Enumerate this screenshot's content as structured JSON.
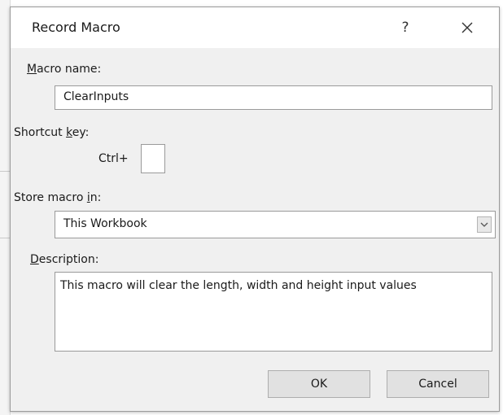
{
  "dialog": {
    "title": "Record Macro",
    "help_glyph": "?",
    "close_glyph": "✕"
  },
  "macro_name": {
    "label_hotkey": "M",
    "label_rest": "acro name:",
    "value": "ClearInputs"
  },
  "shortcut_key": {
    "label_pre": "Shortcut ",
    "label_hotkey": "k",
    "label_post": "ey:",
    "prefix": "Ctrl+",
    "value": ""
  },
  "store_macro": {
    "label_pre": "Store macro ",
    "label_hotkey": "i",
    "label_post": "n:",
    "selected": "This Workbook"
  },
  "description": {
    "label_hotkey": "D",
    "label_rest": "escription:",
    "value": "This macro will clear the length, width and height input values"
  },
  "buttons": {
    "ok": "OK",
    "cancel": "Cancel"
  },
  "colors": {
    "dialog_bg": "#f0f0f0",
    "titlebar_bg": "#ffffff",
    "button_bg": "#e1e1e1"
  }
}
